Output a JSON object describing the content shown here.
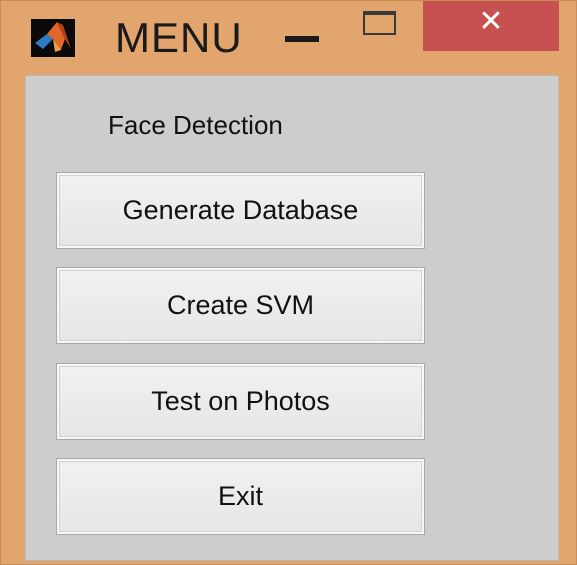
{
  "window": {
    "title": "MENU",
    "icon": "matlab-logo-icon",
    "controls": {
      "minimize_icon": "minimize-icon",
      "maximize_icon": "maximize-icon",
      "close_icon": "close-icon",
      "close_glyph": "✕"
    },
    "colors": {
      "frame": "#e3a56e",
      "close_button": "#c75050",
      "client": "#cdcdcd"
    }
  },
  "panel": {
    "title": "Face Detection",
    "buttons": [
      {
        "label": "Generate Database"
      },
      {
        "label": "Create SVM"
      },
      {
        "label": "Test on Photos"
      },
      {
        "label": "Exit"
      }
    ]
  }
}
